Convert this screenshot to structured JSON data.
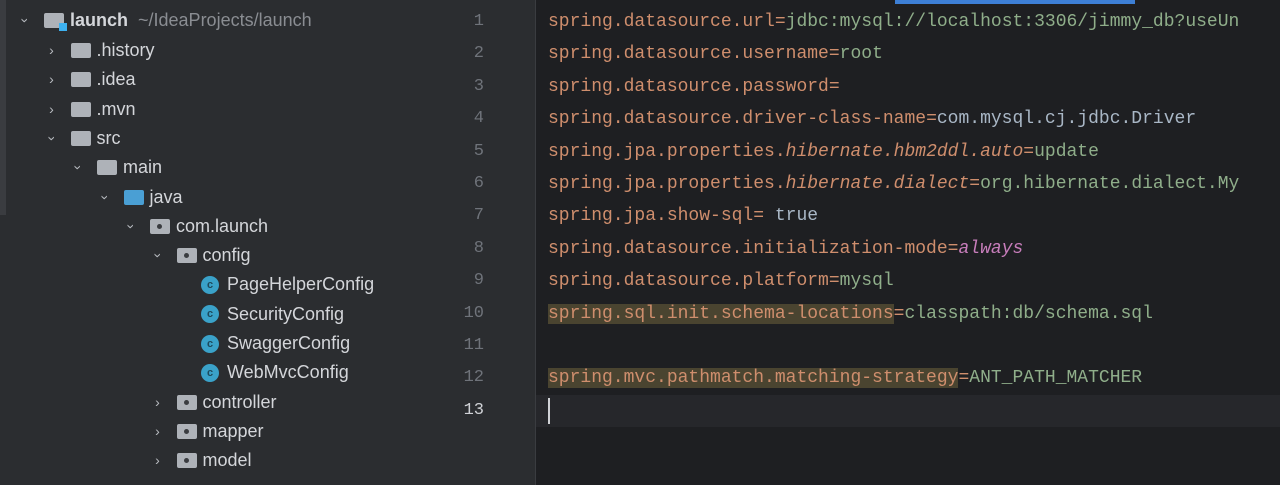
{
  "project_tree": {
    "root": {
      "name": "launch",
      "path": "~/IdeaProjects/launch"
    },
    "items": [
      {
        "label": ".history",
        "depth": 1,
        "type": "folder",
        "expanded": false
      },
      {
        "label": ".idea",
        "depth": 1,
        "type": "folder",
        "expanded": false
      },
      {
        "label": ".mvn",
        "depth": 1,
        "type": "folder",
        "expanded": false
      },
      {
        "label": "src",
        "depth": 1,
        "type": "folder",
        "expanded": true
      },
      {
        "label": "main",
        "depth": 2,
        "type": "folder",
        "expanded": true
      },
      {
        "label": "java",
        "depth": 3,
        "type": "source-folder",
        "expanded": true
      },
      {
        "label": "com.launch",
        "depth": 4,
        "type": "package",
        "expanded": true
      },
      {
        "label": "config",
        "depth": 5,
        "type": "package",
        "expanded": true
      },
      {
        "label": "PageHelperConfig",
        "depth": 6,
        "type": "class"
      },
      {
        "label": "SecurityConfig",
        "depth": 6,
        "type": "class"
      },
      {
        "label": "SwaggerConfig",
        "depth": 6,
        "type": "class"
      },
      {
        "label": "WebMvcConfig",
        "depth": 6,
        "type": "class"
      },
      {
        "label": "controller",
        "depth": 5,
        "type": "package",
        "expanded": false
      },
      {
        "label": "mapper",
        "depth": 5,
        "type": "package",
        "expanded": false
      },
      {
        "label": "model",
        "depth": 5,
        "type": "package",
        "expanded": false
      }
    ]
  },
  "editor": {
    "current_line": 13,
    "lines": [
      {
        "n": "1",
        "tokens": [
          {
            "t": "spring.datasource.url",
            "c": "k"
          },
          {
            "t": "=",
            "c": "eq"
          },
          {
            "t": "jdbc:mysql://localhost:3306/jimmy_db?useUn",
            "c": "v"
          }
        ]
      },
      {
        "n": "2",
        "tokens": [
          {
            "t": "spring.datasource.username",
            "c": "k"
          },
          {
            "t": "=",
            "c": "eq"
          },
          {
            "t": "root",
            "c": "v"
          }
        ]
      },
      {
        "n": "3",
        "tokens": [
          {
            "t": "spring.datasource.password",
            "c": "k"
          },
          {
            "t": "=",
            "c": "eq"
          }
        ]
      },
      {
        "n": "4",
        "tokens": [
          {
            "t": "spring.datasource.driver-class-name",
            "c": "k"
          },
          {
            "t": "=",
            "c": "eq"
          },
          {
            "t": "com.mysql.cj.jdbc.Driver",
            "c": "vb"
          }
        ]
      },
      {
        "n": "5",
        "tokens": [
          {
            "t": "spring.jpa.properties.",
            "c": "k"
          },
          {
            "t": "hibernate.hbm2ddl.auto",
            "c": "ki"
          },
          {
            "t": "=",
            "c": "eq"
          },
          {
            "t": "update",
            "c": "v"
          }
        ]
      },
      {
        "n": "6",
        "tokens": [
          {
            "t": "spring.jpa.properties.",
            "c": "k"
          },
          {
            "t": "hibernate.dialect",
            "c": "ki"
          },
          {
            "t": "=",
            "c": "eq"
          },
          {
            "t": "org.hibernate.dialect.My",
            "c": "v"
          }
        ]
      },
      {
        "n": "7",
        "tokens": [
          {
            "t": "spring.jpa.show-sql",
            "c": "k"
          },
          {
            "t": "= ",
            "c": "eq"
          },
          {
            "t": "true",
            "c": "vb"
          }
        ]
      },
      {
        "n": "8",
        "tokens": [
          {
            "t": "spring.datasource.initialization-mode",
            "c": "k"
          },
          {
            "t": "=",
            "c": "eq"
          },
          {
            "t": "always",
            "c": "vp"
          }
        ]
      },
      {
        "n": "9",
        "tokens": [
          {
            "t": "spring.datasource.platform",
            "c": "k"
          },
          {
            "t": "=",
            "c": "eq"
          },
          {
            "t": "mysql",
            "c": "v"
          }
        ]
      },
      {
        "n": "10",
        "tokens": [
          {
            "t": "spring.sql.init.schema-locations",
            "c": "k hl"
          },
          {
            "t": "=",
            "c": "eq"
          },
          {
            "t": "classpath:db/schema.sql",
            "c": "v"
          }
        ]
      },
      {
        "n": "11",
        "tokens": []
      },
      {
        "n": "12",
        "tokens": [
          {
            "t": "spring.mvc.pathmatch.matching-strategy",
            "c": "k hl"
          },
          {
            "t": "=",
            "c": "eq"
          },
          {
            "t": "ANT_PATH_MATCHER",
            "c": "v"
          }
        ]
      },
      {
        "n": "13",
        "tokens": []
      }
    ]
  }
}
